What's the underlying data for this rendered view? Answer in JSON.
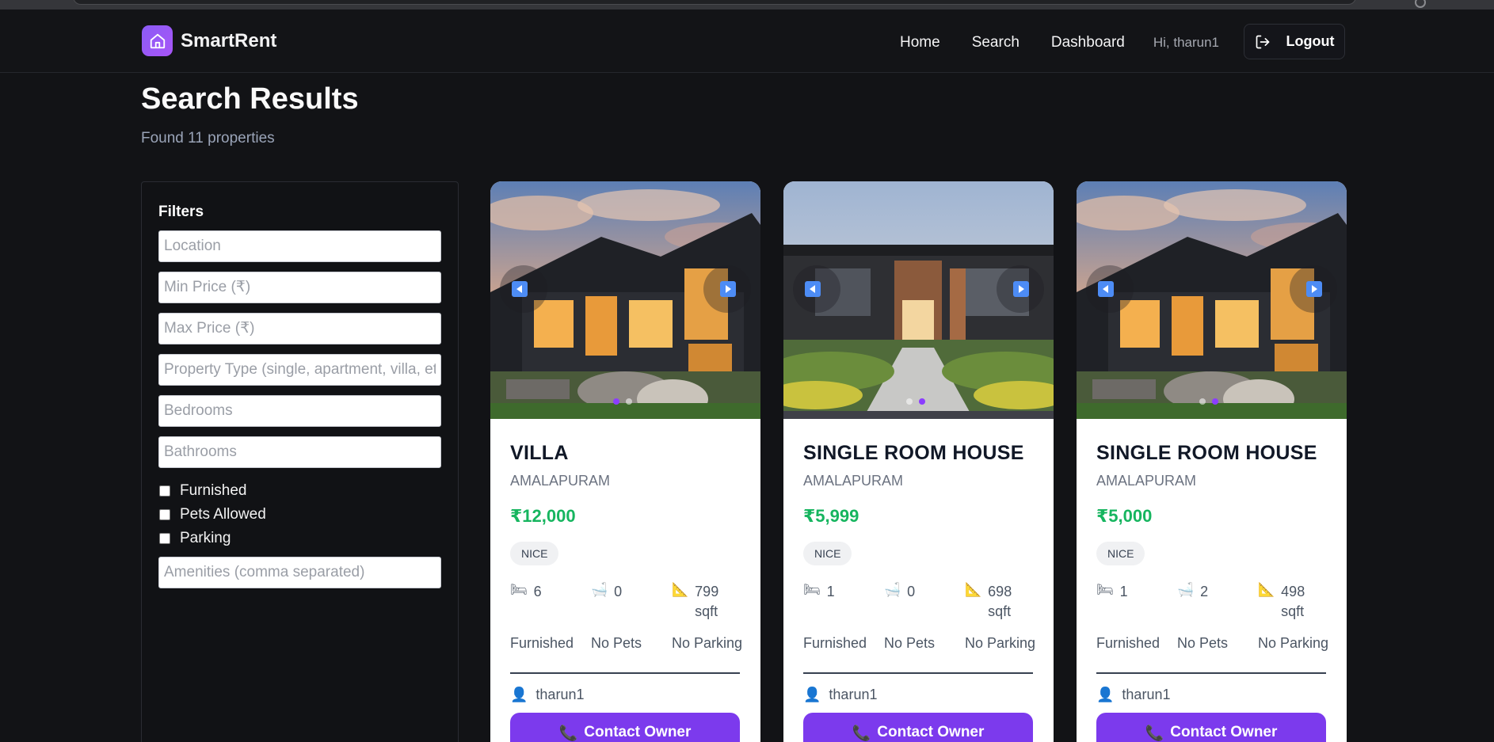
{
  "brand": {
    "name": "SmartRent",
    "logo_icon": "house-icon",
    "accent": "#8b5cf6"
  },
  "nav": {
    "links": [
      "Home",
      "Search",
      "Dashboard"
    ],
    "greeting": "Hi, tharun1",
    "logout_label": "Logout"
  },
  "page": {
    "title": "Search Results",
    "subtitle": "Found 11 properties"
  },
  "filters": {
    "title": "Filters",
    "location_placeholder": "Location",
    "min_price_placeholder": "Min Price (₹)",
    "max_price_placeholder": "Max Price (₹)",
    "type_placeholder": "Property Type (single, apartment, villa, etc.)",
    "bedrooms_placeholder": "Bedrooms",
    "bathrooms_placeholder": "Bathrooms",
    "checkboxes": [
      "Furnished",
      "Pets Allowed",
      "Parking"
    ],
    "amenities_placeholder": "Amenities (comma separated)"
  },
  "cards": [
    {
      "title": "VILLA",
      "location": "AMALAPURAM",
      "price": "₹12,000",
      "tag": "NICE",
      "bedrooms": "6",
      "bathrooms": "0",
      "area": "799",
      "area_unit": "sqft",
      "furnished": "Furnished",
      "pets": "No Pets",
      "parking": "No Parking",
      "owner": "tharun1",
      "contact_label": "Contact Owner",
      "image_dots": 2,
      "active_dot": 0
    },
    {
      "title": "SINGLE ROOM HOUSE",
      "location": "AMALAPURAM",
      "price": "₹5,999",
      "tag": "NICE",
      "bedrooms": "1",
      "bathrooms": "0",
      "area": "698",
      "area_unit": "sqft",
      "furnished": "Furnished",
      "pets": "No Pets",
      "parking": "No Parking",
      "owner": "tharun1",
      "contact_label": "Contact Owner",
      "image_dots": 2,
      "active_dot": 1
    },
    {
      "title": "SINGLE ROOM HOUSE",
      "location": "AMALAPURAM",
      "price": "₹5,000",
      "tag": "NICE",
      "bedrooms": "1",
      "bathrooms": "2",
      "area": "498",
      "area_unit": "sqft",
      "furnished": "Furnished",
      "pets": "No Pets",
      "parking": "No Parking",
      "owner": "tharun1",
      "contact_label": "Contact Owner",
      "image_dots": 2,
      "active_dot": 1
    }
  ],
  "icons": {
    "bed": "bed-icon",
    "bath": "bath-icon",
    "area": "ruler-icon",
    "owner": "user-icon",
    "contact": "phone-icon"
  }
}
